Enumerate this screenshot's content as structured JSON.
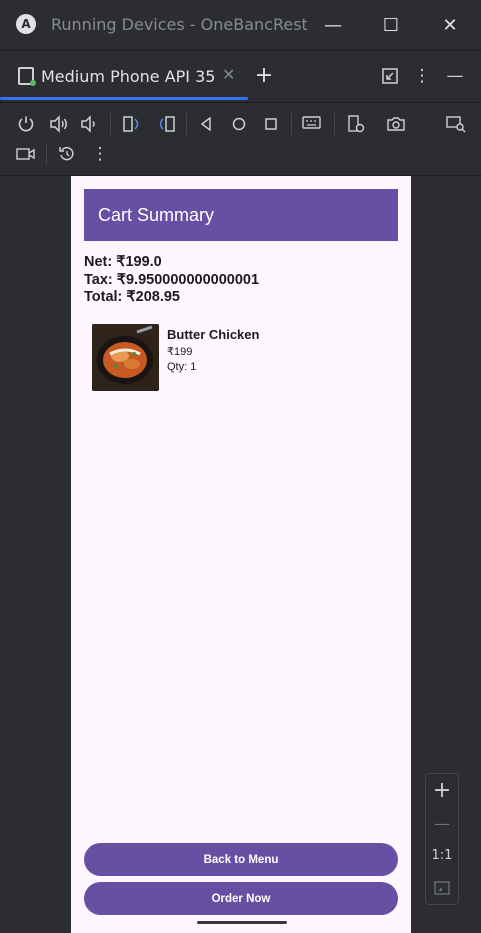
{
  "window": {
    "title": "Running Devices - OneBancResta",
    "minimize_glyph": "—",
    "maximize_glyph": "☐",
    "close_glyph": "✕"
  },
  "tabs": [
    {
      "label": "Medium Phone API 35",
      "close_glyph": "✕"
    }
  ],
  "tabbar": {
    "add_glyph": "+",
    "more_glyph": "⋮",
    "hide_glyph": "—"
  },
  "toolbar": {
    "icons": [
      "power-icon",
      "volume-up-icon",
      "volume-down-icon",
      "rotate-left-icon",
      "rotate-right-icon",
      "back-icon",
      "home-icon",
      "overview-icon",
      "keyboard-icon",
      "device-settings-icon",
      "camera-icon",
      "screen-record-icon",
      "reset-icon",
      "more-icon",
      "mirror-options-icon"
    ]
  },
  "app": {
    "appbar_title": "Cart Summary",
    "summary": {
      "net": "Net: ₹199.0",
      "tax": "Tax: ₹9.950000000000001",
      "total": "Total: ₹208.95"
    },
    "items": [
      {
        "name": "Butter Chicken",
        "price": "₹199",
        "qty": "Qty: 1"
      }
    ],
    "buttons": {
      "back": "Back to Menu",
      "order": "Order Now"
    }
  },
  "zoom": {
    "zoom_in": "+",
    "zoom_out": "—",
    "actual_size": "1:1"
  },
  "colors": {
    "ide_bg": "#2b2d30",
    "accent": "#3574f0",
    "app_primary": "#6750a4",
    "app_surface": "#fef7ff"
  }
}
